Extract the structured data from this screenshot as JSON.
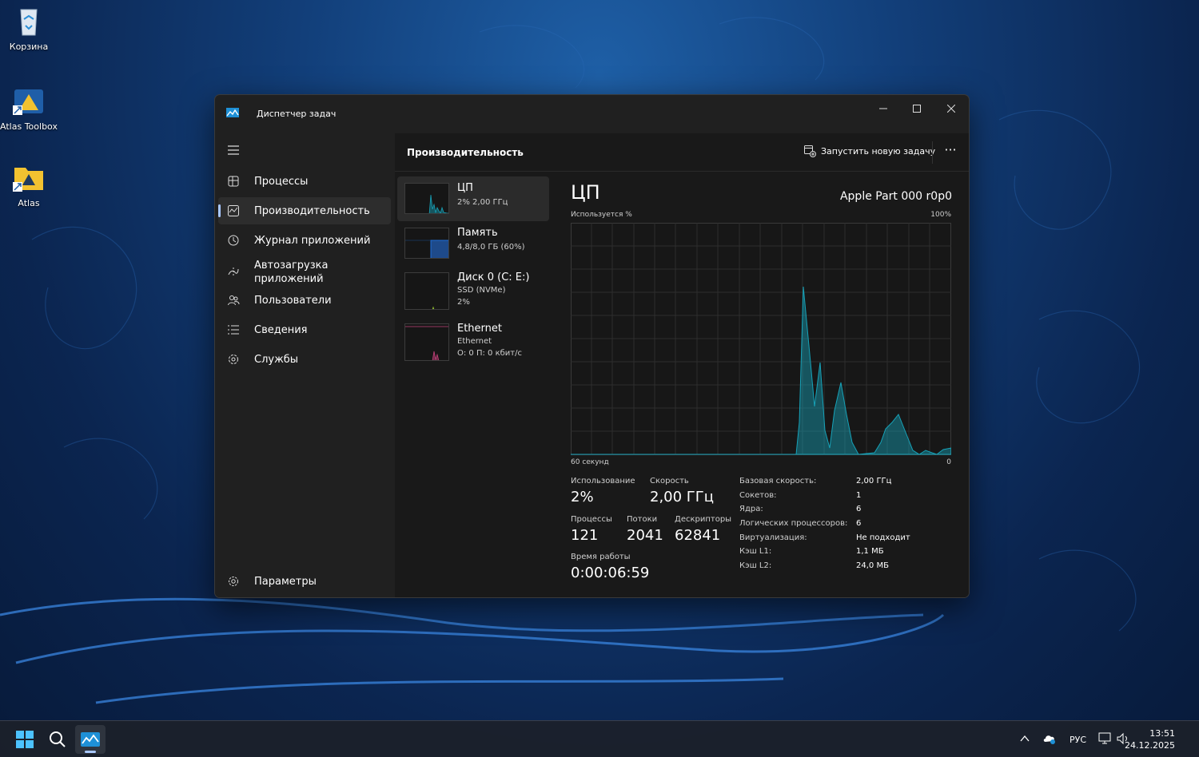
{
  "desktop": {
    "icons": [
      {
        "label": "Корзина"
      },
      {
        "label": "Atlas Toolbox"
      },
      {
        "label": "Atlas"
      }
    ]
  },
  "window": {
    "title": "Диспетчер задач"
  },
  "sidebar": {
    "items": [
      {
        "label": "Процессы",
        "icon": "processes-icon"
      },
      {
        "label": "Производительность",
        "icon": "performance-icon",
        "active": true
      },
      {
        "label": "Журнал приложений",
        "icon": "history-icon"
      },
      {
        "label": "Автозагрузка приложений",
        "icon": "startup-icon"
      },
      {
        "label": "Пользователи",
        "icon": "users-icon"
      },
      {
        "label": "Сведения",
        "icon": "details-icon"
      },
      {
        "label": "Службы",
        "icon": "services-icon"
      }
    ],
    "settings_label": "Параметры"
  },
  "header": {
    "title": "Производительность",
    "run_task_label": "Запустить новую задачу",
    "more_label": "···"
  },
  "resources": [
    {
      "name": "ЦП",
      "sub1": "2%  2,00 ГГц",
      "sub2": "",
      "active": true
    },
    {
      "name": "Память",
      "sub1": "4,8/8,0 ГБ (60%)",
      "sub2": ""
    },
    {
      "name": "Диск 0 (C: E:)",
      "sub1": "SSD (NVMe)",
      "sub2": "2%"
    },
    {
      "name": "Ethernet",
      "sub1": "Ethernet",
      "sub2": "О: 0 П: 0 кбит/с"
    }
  ],
  "detail": {
    "title": "ЦП",
    "model": "Apple Part 000 r0p0",
    "usage_label": "Используется %",
    "max_label": "100%",
    "time_label": "60 секунд",
    "min_label": "0",
    "stats": {
      "usage_label": "Использование",
      "usage_value": "2%",
      "speed_label": "Скорость",
      "speed_value": "2,00 ГГц",
      "processes_label": "Процессы",
      "processes_value": "121",
      "threads_label": "Потоки",
      "threads_value": "2041",
      "handles_label": "Дескрипторы",
      "handles_value": "62841",
      "uptime_label": "Время работы",
      "uptime_value": "0:00:06:59"
    },
    "specs": [
      {
        "k": "Базовая скорость:",
        "v": "2,00 ГГц"
      },
      {
        "k": "Сокетов:",
        "v": "1"
      },
      {
        "k": "Ядра:",
        "v": "6"
      },
      {
        "k": "Логических процессоров:",
        "v": "6"
      },
      {
        "k": "Виртуализация:",
        "v": "Не подходит"
      },
      {
        "k": "Кэш L1:",
        "v": "1,1 МБ"
      },
      {
        "k": "Кэш L2:",
        "v": "24,0 МБ"
      }
    ]
  },
  "taskbar": {
    "language": "РУС",
    "time": "13:51",
    "date": "24.12.2025"
  },
  "colors": {
    "accent": "#a8c7ff",
    "cpu_graph": "#17a2b8",
    "memory_graph": "#1e6fd9",
    "ethernet_graph": "#c2407a"
  }
}
